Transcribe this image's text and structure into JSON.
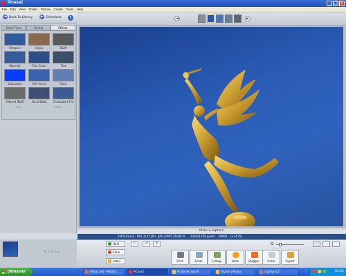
{
  "window": {
    "title": "Picasa2"
  },
  "menu": [
    "File",
    "Edit",
    "View",
    "Folder",
    "Picture",
    "Create",
    "Tools",
    "Help"
  ],
  "left": {
    "back_label": "Back To Library",
    "slideshow_label": "Slideshow",
    "help_label": "?",
    "tabs": [
      "Basic Fixes",
      "Tuning",
      "Effects"
    ],
    "effects": [
      {
        "label": "Sharpen",
        "color": "#2f5a9e"
      },
      {
        "label": "Sepia",
        "color": "#8a6a4a"
      },
      {
        "label": "B&W",
        "color": "#5a5a5a"
      },
      {
        "label": "Warmify",
        "color": "#335c9c"
      },
      {
        "label": "Film Grain",
        "color": "#2c4f86"
      },
      {
        "label": "Tint",
        "color": "#3a4f6a"
      },
      {
        "label": "Saturation",
        "color": "#0a3cff"
      },
      {
        "label": "Soft Focus",
        "color": "#3862aa"
      },
      {
        "label": "Glow",
        "color": "#5f7fb8"
      },
      {
        "label": "Filtered B&W",
        "color": "#6b6b6b"
      },
      {
        "label": "Focal B&W",
        "color": "#3d4f74"
      },
      {
        "label": "Graduated Tint",
        "color": "#3d5c93"
      }
    ],
    "undo_label": "Undo",
    "redo_label": "Redo"
  },
  "caption": {
    "placeholder": "Make a caption!"
  },
  "info": {
    "date": "2005-01-03 - 100_1115.JPG",
    "taken": "8/01/2005 16:08:35",
    "size": "2304x1728 pixels",
    "filesize": "394KB",
    "count": "(2 of 25)"
  },
  "tray": {
    "label": "Picture Tray",
    "hold": "Hold",
    "clear": "Clear",
    "label_btn": "Label",
    "actions": [
      "Print",
      "Email",
      "Collage",
      "Hello",
      "Blogger",
      "Order",
      "Export"
    ]
  },
  "taskbar": {
    "start": "démarrer",
    "tasks": [
      "eldrus.net - Mozilla ...",
      "Picasa2",
      "Poste de travail",
      "Favoris réseau",
      "2 gimp-2.2"
    ],
    "clock": "02:25"
  }
}
